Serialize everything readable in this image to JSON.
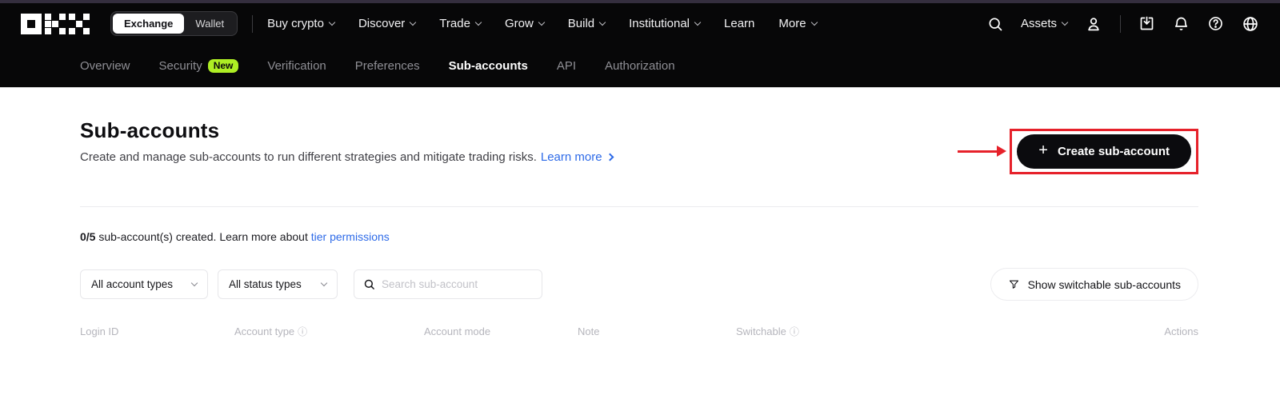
{
  "header": {
    "brand": "OKX",
    "toggle": {
      "exchange": "Exchange",
      "wallet": "Wallet"
    },
    "nav": [
      {
        "label": "Buy crypto"
      },
      {
        "label": "Discover"
      },
      {
        "label": "Trade"
      },
      {
        "label": "Grow"
      },
      {
        "label": "Build"
      },
      {
        "label": "Institutional"
      },
      {
        "label": "Learn"
      },
      {
        "label": "More"
      }
    ],
    "assets_label": "Assets"
  },
  "subnav": {
    "items": [
      {
        "label": "Overview"
      },
      {
        "label": "Security",
        "badge": "New"
      },
      {
        "label": "Verification"
      },
      {
        "label": "Preferences"
      },
      {
        "label": "Sub-accounts"
      },
      {
        "label": "API"
      },
      {
        "label": "Authorization"
      }
    ]
  },
  "page": {
    "title": "Sub-accounts",
    "description": "Create and manage sub-accounts to run different strategies and mitigate trading risks.",
    "learn_more_label": "Learn more",
    "create_button_label": "Create sub-account",
    "create_button_plus": "+",
    "summary": {
      "count": "0/5",
      "text": " sub-account(s) created. Learn more about ",
      "link_label": "tier permissions"
    },
    "filters": {
      "account_type_value": "All account types",
      "status_type_value": "All status types",
      "search_placeholder": "Search sub-account",
      "switchable_toggle_label": "Show switchable sub-accounts"
    },
    "table": {
      "headers": [
        {
          "label": "Login ID"
        },
        {
          "label": "Account type",
          "info": "ⓘ"
        },
        {
          "label": "Account mode"
        },
        {
          "label": "Note"
        },
        {
          "label": "Switchable",
          "info": "ⓘ"
        },
        {
          "label": "Actions"
        }
      ]
    }
  },
  "colors": {
    "topbar_bg": "#070708",
    "badge_green": "#aeee24",
    "link_blue": "#2d6ae8",
    "annotation_red": "#e6212a",
    "create_button_bg": "#0b0b0e"
  }
}
